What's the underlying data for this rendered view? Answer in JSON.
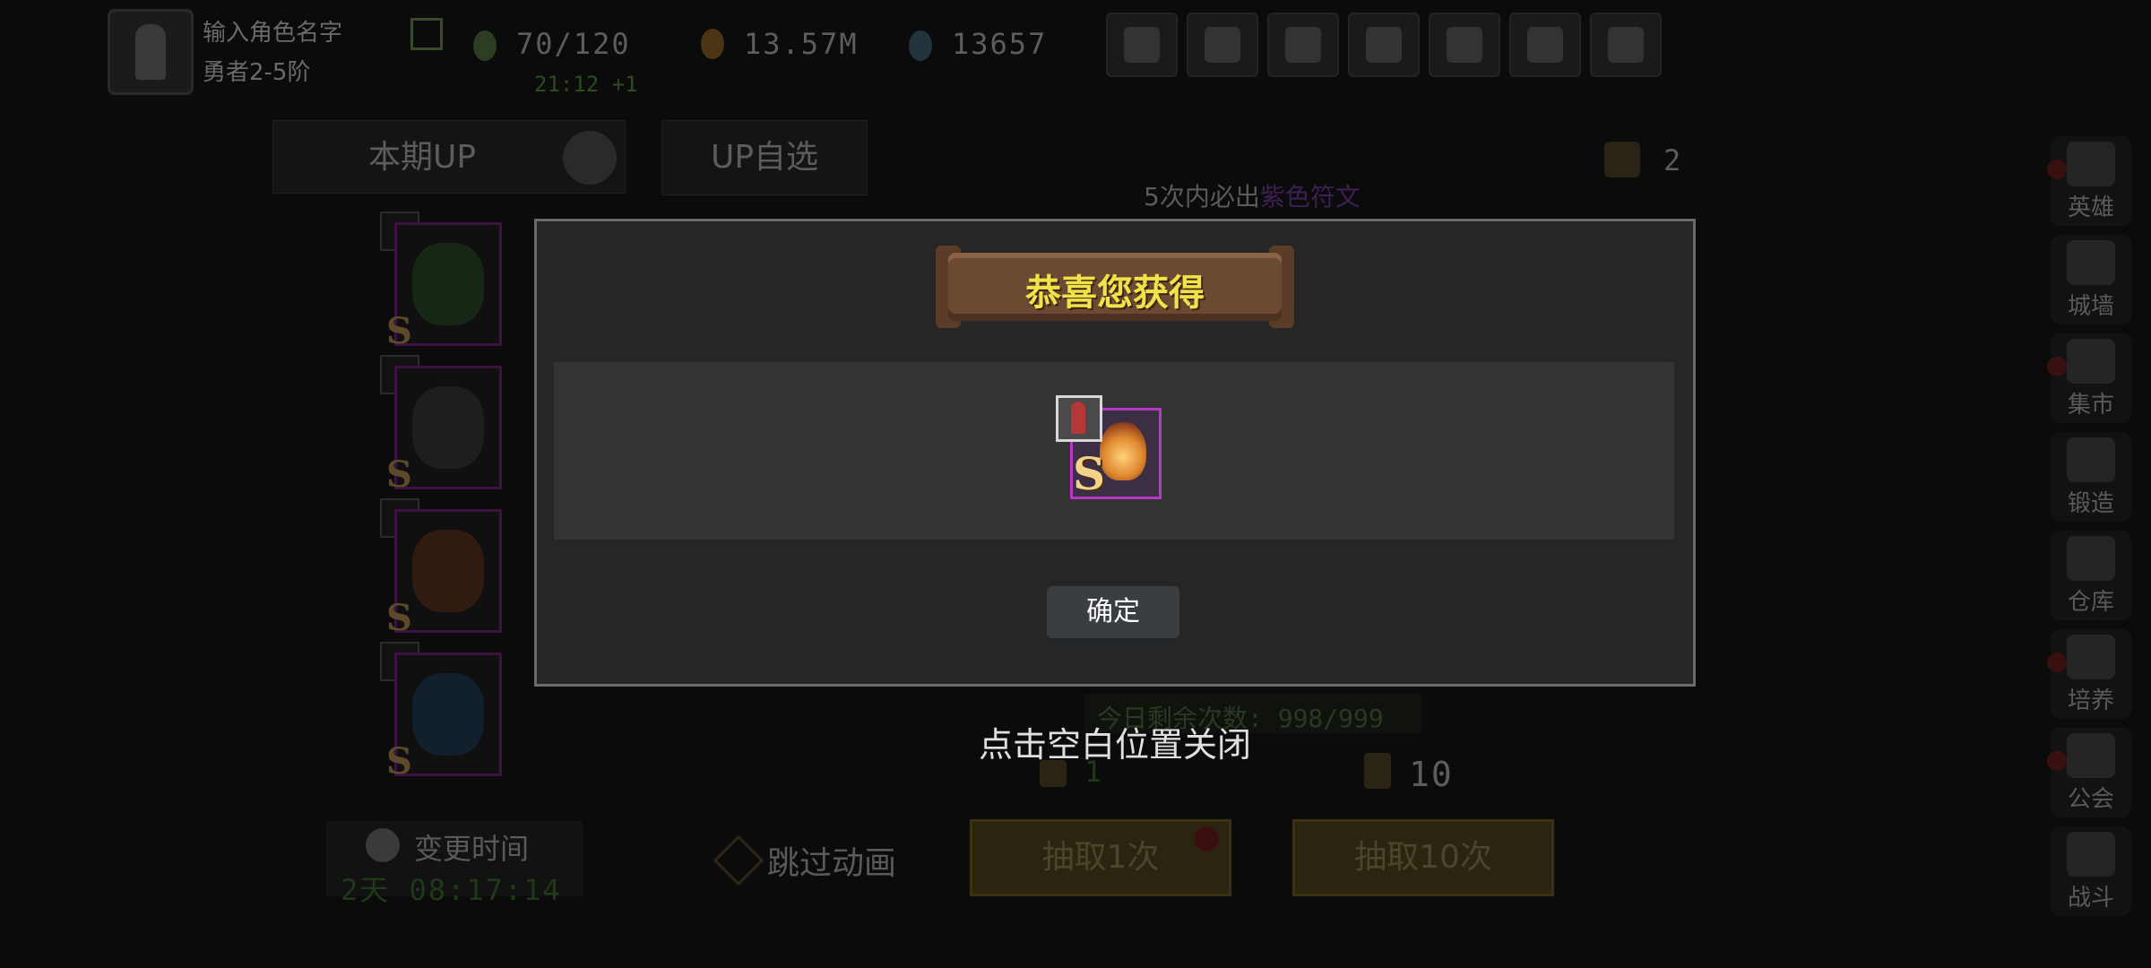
{
  "player": {
    "name_placeholder": "输入角色名字",
    "rank": "勇者2-5阶"
  },
  "resources": {
    "stamina": "70/120",
    "stamina_timer": "21:12 +1",
    "gold": "13.57M",
    "gems": "13657"
  },
  "top_icons": [
    "cart-icon",
    "mail-icon",
    "gamepad-icon",
    "gear-icon",
    "gift-icon",
    "color-wheel-icon",
    "wand-icon"
  ],
  "tabs": {
    "current_up": "本期UP",
    "up_select": "UP自选"
  },
  "ticket_count": "2",
  "guarantee": {
    "prefix": "5次内必出",
    "highlight": "紫色符文"
  },
  "side_menu": [
    "英雄",
    "城墙",
    "集市",
    "锻造",
    "仓库",
    "培养",
    "公会",
    "战斗"
  ],
  "rate_cards": [
    {
      "grade": "S",
      "color": "#2f4a2a"
    },
    {
      "grade": "S",
      "color": "#3a3a3a"
    },
    {
      "grade": "S",
      "color": "#5a2a12"
    },
    {
      "grade": "S",
      "color": "#1a3a55"
    }
  ],
  "change_time": {
    "label": "变更时间",
    "remaining": "2天 08:17:14"
  },
  "daily_remaining": "今日剩余次数: 998/999",
  "cost_single": "1",
  "cost_ten": "10",
  "skip_animation": "跳过动画",
  "draw_once": "抽取1次",
  "draw_ten": "抽取10次",
  "modal": {
    "title": "恭喜您获得",
    "reward": {
      "grade": "S",
      "frame_color": "#b53ac3"
    },
    "confirm": "确定",
    "close_hint": "点击空白位置关闭"
  }
}
